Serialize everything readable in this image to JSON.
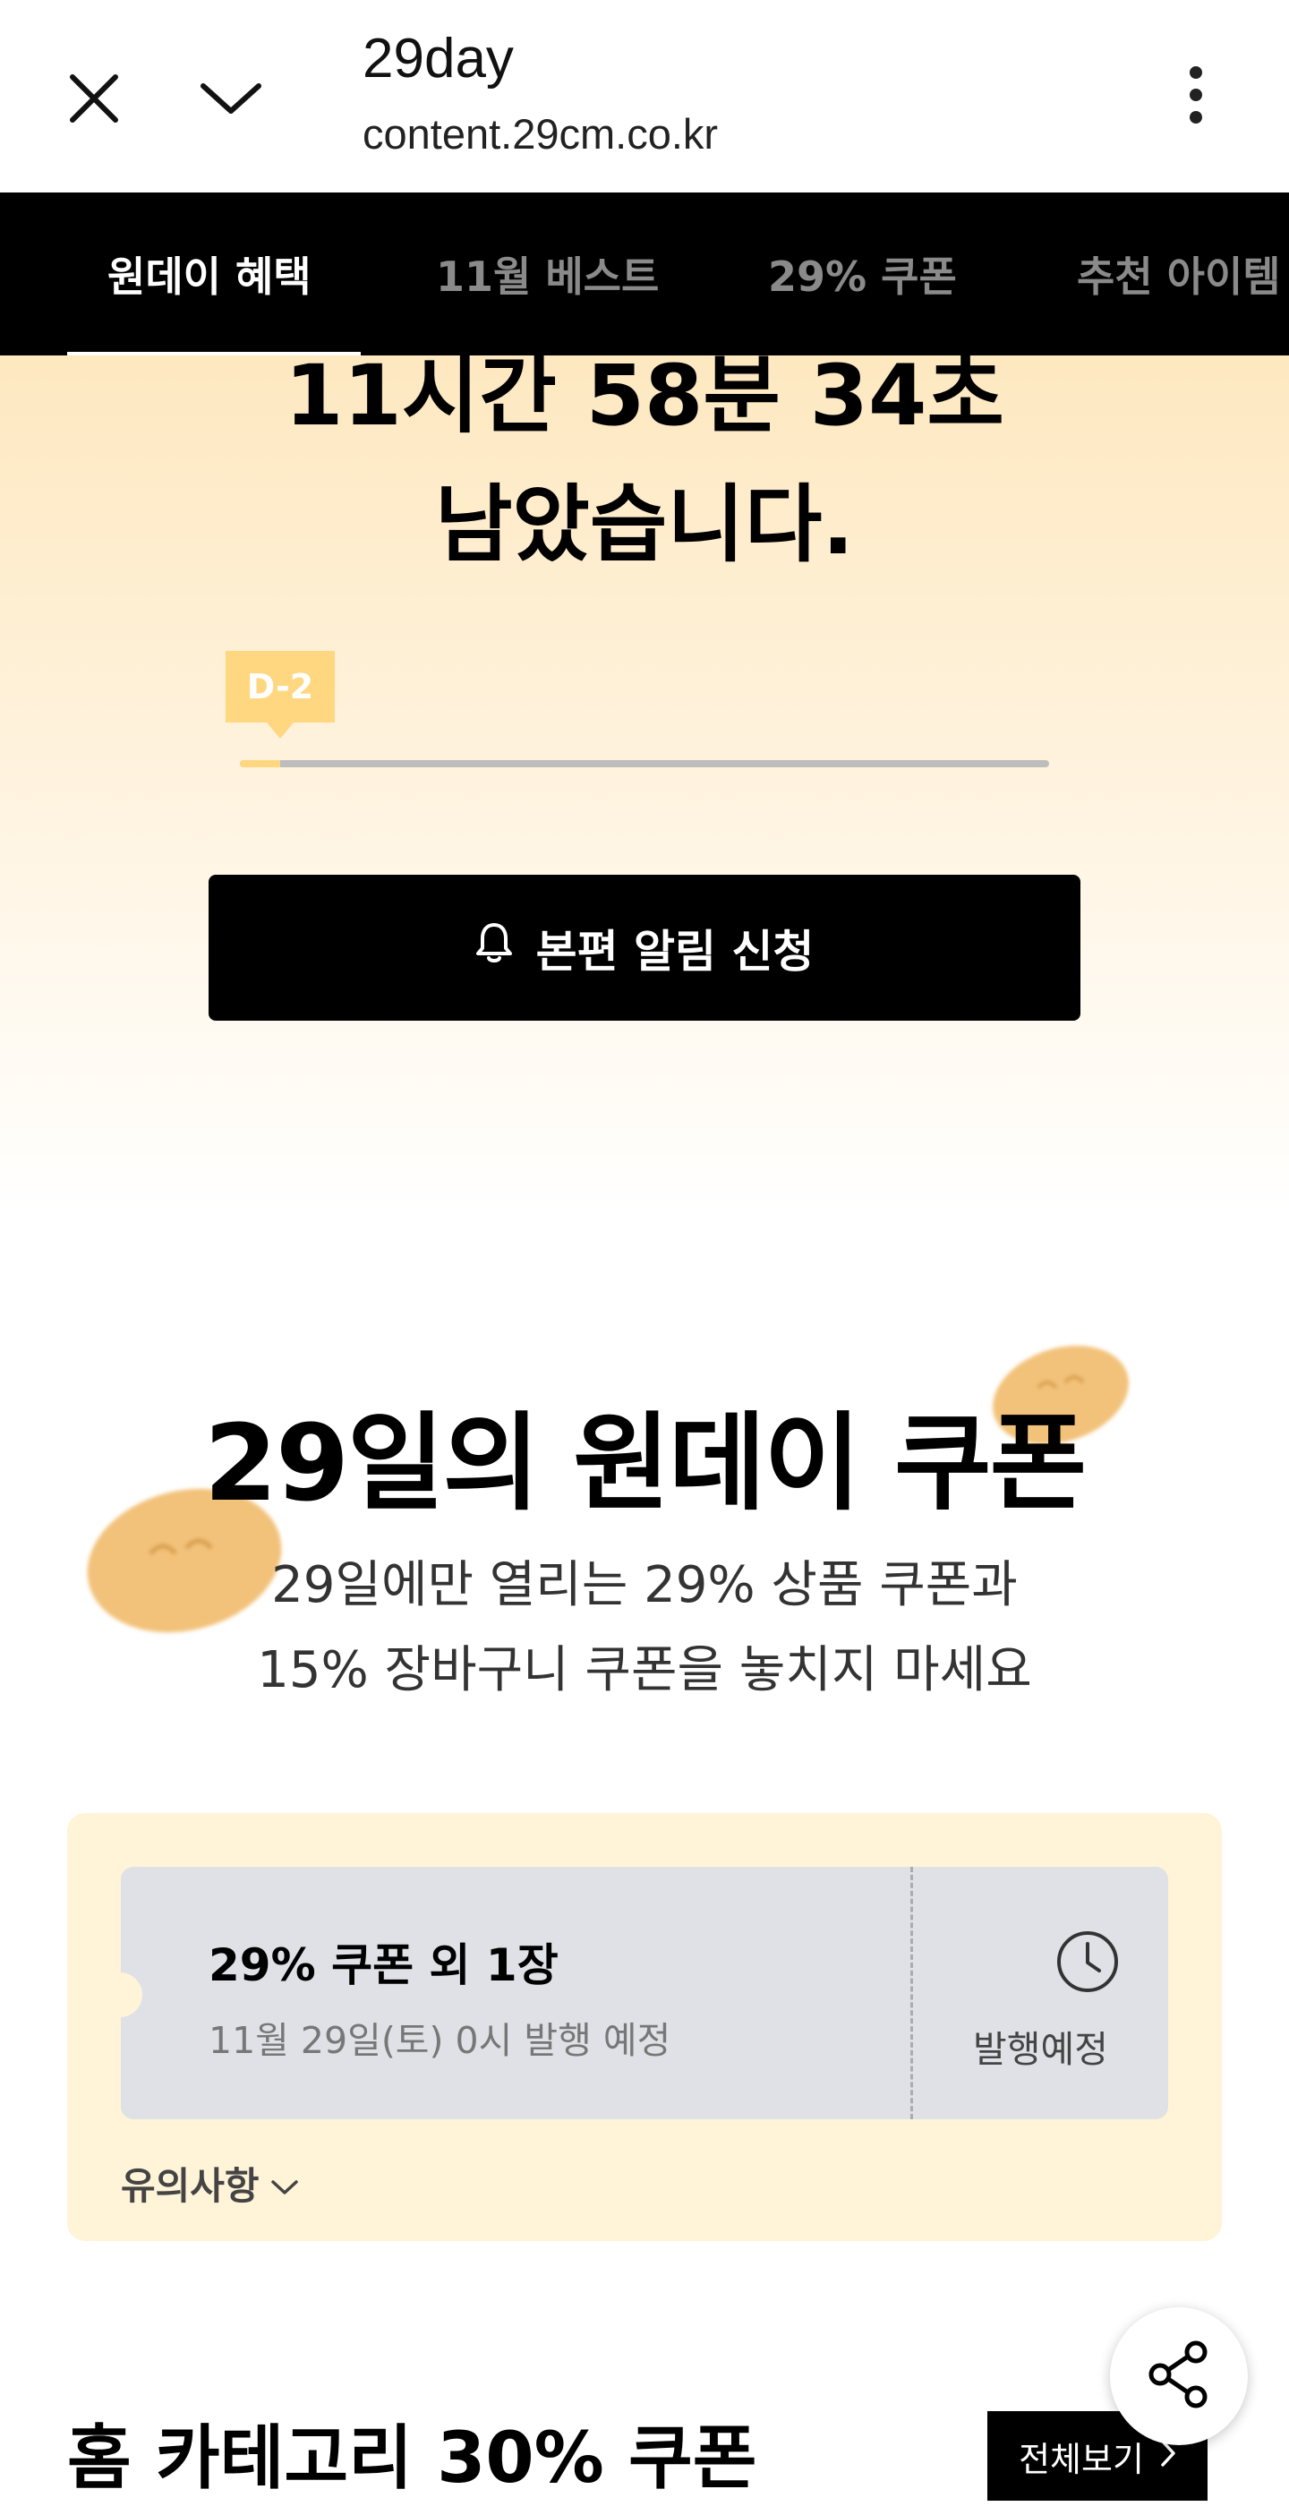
{
  "browser": {
    "title": "29day",
    "url": "content.29cm.co.kr"
  },
  "tabs": [
    {
      "label": "원데이 혜택"
    },
    {
      "label": "11월 베스트"
    },
    {
      "label": "29% 쿠폰"
    },
    {
      "label": "추천 아이템"
    }
  ],
  "hero": {
    "countdown": "11시간 58분 34초",
    "countdown_suffix": "남았습니다.",
    "d_badge": "D-2",
    "progress_fraction": 0.05,
    "notify_button": "본편 알림 신청"
  },
  "coupon_section": {
    "title": "29일의 원데이 쿠폰",
    "subtitle_line1": "29일에만 열리는 29% 상품 쿠폰과",
    "subtitle_line2": "15% 장바구니 쿠폰을 놓치지 마세요",
    "coupon": {
      "title": "29% 쿠폰 외 1장",
      "schedule": "11월 29일(토) 0시 발행 예정",
      "status": "발행예정"
    },
    "notice_label": "유의사항"
  },
  "home_category": {
    "title": "홈 카테고리 30% 쿠폰",
    "view_all": "전체보기"
  },
  "colors": {
    "accent_yellow": "#ffd781",
    "coupon_bg": "#fff4d8",
    "ticket_bg": "#dfe1e6"
  },
  "icons": [
    "close-icon",
    "chevron-down-icon",
    "more-vertical-icon",
    "bell-icon",
    "clock-icon",
    "chevron-right-icon",
    "share-icon",
    "cookie-decoration"
  ]
}
